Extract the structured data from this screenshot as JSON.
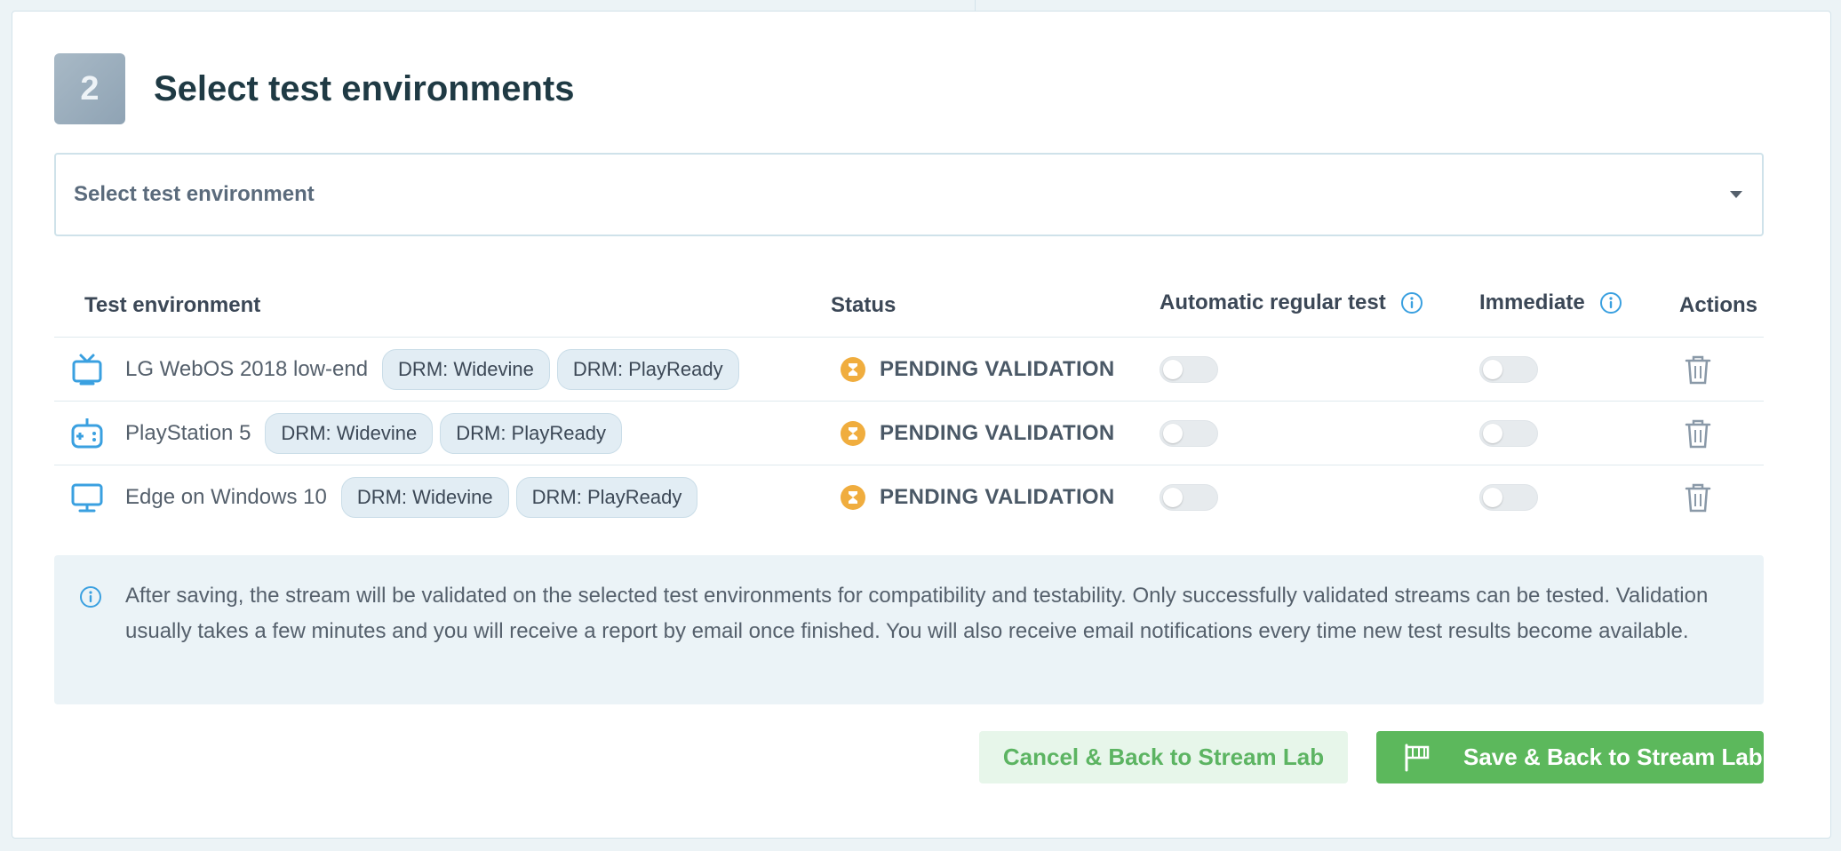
{
  "step": {
    "number": "2",
    "title": "Select test environments"
  },
  "env_select": {
    "placeholder": "Select test environment"
  },
  "table": {
    "headers": {
      "environment": "Test environment",
      "status": "Status",
      "automatic": "Automatic regular test",
      "immediate": "Immediate",
      "actions": "Actions"
    },
    "rows": [
      {
        "icon": "tv-icon",
        "name": "LG WebOS 2018 low-end",
        "tags": [
          "DRM: Widevine",
          "DRM: PlayReady"
        ],
        "status": "PENDING VALIDATION",
        "automatic": false,
        "immediate": false
      },
      {
        "icon": "gamepad-icon",
        "name": "PlayStation 5",
        "tags": [
          "DRM: Widevine",
          "DRM: PlayReady"
        ],
        "status": "PENDING VALIDATION",
        "automatic": false,
        "immediate": false
      },
      {
        "icon": "monitor-icon",
        "name": "Edge on Windows 10",
        "tags": [
          "DRM: Widevine",
          "DRM: PlayReady"
        ],
        "status": "PENDING VALIDATION",
        "automatic": false,
        "immediate": false
      }
    ]
  },
  "info": {
    "text": "After saving, the stream will be validated on the selected test environments for compatibility and testability. Only successfully validated streams can be tested. Validation usually takes a few minutes and you will receive a report by email once finished. You will also receive email notifications every time new test results become available."
  },
  "buttons": {
    "cancel": "Cancel & Back to Stream Lab",
    "save": "Save & Back to Stream Lab"
  },
  "colors": {
    "accent_blue": "#3aa0e0",
    "pending": "#f0ad3e",
    "success": "#5cb85c"
  }
}
